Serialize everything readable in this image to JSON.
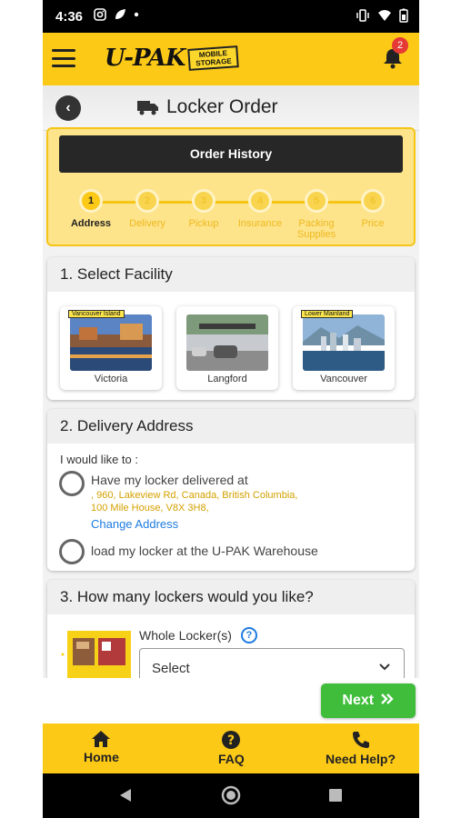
{
  "status_bar": {
    "time": "4:36"
  },
  "header": {
    "logo_word": "U-PAK",
    "logo_tag_line1": "MOBILE",
    "logo_tag_line2": "STORAGE",
    "notification_count": "2"
  },
  "title_bar": {
    "title": "Locker Order"
  },
  "steps": {
    "order_history_label": "Order History",
    "items": [
      {
        "num": "1",
        "label": "Address"
      },
      {
        "num": "2",
        "label": "Delivery"
      },
      {
        "num": "3",
        "label": "Pickup"
      },
      {
        "num": "4",
        "label": "Insurance"
      },
      {
        "num": "5",
        "label": "Packing Supplies"
      },
      {
        "num": "6",
        "label": "Price"
      }
    ]
  },
  "facility": {
    "heading": "1. Select Facility",
    "options": [
      {
        "name": "Victoria",
        "tag": "Vancouver Island"
      },
      {
        "name": "Langford",
        "tag": ""
      },
      {
        "name": "Vancouver",
        "tag": "Lower Mainland"
      }
    ]
  },
  "delivery": {
    "heading": "2. Delivery Address",
    "prompt": "I would like to :",
    "option1": "Have my locker delivered at",
    "address_line1": ", 960, Lakeview Rd, Canada, British Columbia,",
    "address_line2": "100 Mile House, V8X 3H8,",
    "change_address": "Change Address",
    "option2": "load my locker at the U-PAK Warehouse"
  },
  "lockers": {
    "heading": "3. How many lockers would you like?",
    "whole_locker_label": "Whole Locker(s)",
    "help_glyph": "?",
    "select_value": "Select"
  },
  "next_button": "Next",
  "bottom_nav": {
    "home": "Home",
    "faq": "FAQ",
    "help": "Need Help?"
  },
  "colors": {
    "brand_yellow": "#fcc917",
    "next_green": "#3fbd3b",
    "link_blue": "#1e7be0",
    "address_gold": "#d4a100"
  }
}
